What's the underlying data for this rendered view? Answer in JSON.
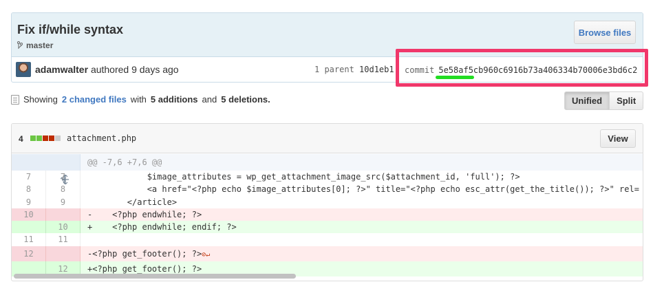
{
  "commit": {
    "title": "Fix if/while syntax",
    "branch": "master",
    "browse_label": "Browse files",
    "author": "adamwalter",
    "authored_text": "authored 9 days ago",
    "parent_label": "1 parent",
    "parent_sha": "10d1eb1",
    "commit_label": "commit",
    "commit_sha": "5e58af5cb960c6916b73a406334b70006e3bd6c2"
  },
  "toc": {
    "showing": "Showing",
    "changed_files": "2 changed files",
    "with": "with",
    "additions": "5 additions",
    "and": "and",
    "deletions": "5 deletions."
  },
  "view_toggle": {
    "unified": "Unified",
    "split": "Split"
  },
  "file": {
    "count": "4",
    "name": "attachment.php",
    "view_label": "View",
    "diffstat_colors": [
      "#6cc644",
      "#6cc644",
      "#bd2c00",
      "#bd2c00",
      "#cccccc"
    ]
  },
  "diff": {
    "hunk": "@@ -7,6 +7,6 @@",
    "rows": [
      {
        "old": "7",
        "new": "7",
        "type": "ctx",
        "text": "            $image_attributes = wp_get_attachment_image_src($attachment_id, 'full'); ?>"
      },
      {
        "old": "8",
        "new": "8",
        "type": "ctx",
        "text": "            <a href=\"<?php echo $image_attributes[0]; ?>\" title=\"<?php echo esc_attr(get_the_title()); ?>\" rel="
      },
      {
        "old": "9",
        "new": "9",
        "type": "ctx",
        "text": "        </article>"
      },
      {
        "old": "10",
        "new": "",
        "type": "del",
        "text": "-    <?php endwhile; ?>"
      },
      {
        "old": "",
        "new": "10",
        "type": "add",
        "text": "+    <?php endwhile; endif; ?>"
      },
      {
        "old": "11",
        "new": "11",
        "type": "ctx",
        "text": ""
      },
      {
        "old": "12",
        "new": "",
        "type": "del",
        "text": "-<?php get_footer(); ?>"
      },
      {
        "old": "",
        "new": "12",
        "type": "add",
        "text": "+<?php get_footer(); ?>"
      }
    ]
  },
  "colors": {
    "link": "#4078c0",
    "annotation_box": "#f0386b",
    "annotation_underline": "#22dd22"
  }
}
